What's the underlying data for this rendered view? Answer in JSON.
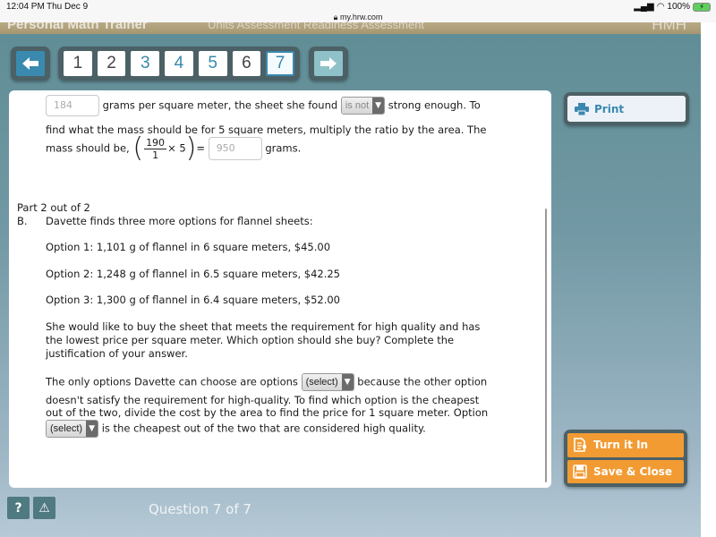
{
  "status_bar": {
    "time": "12:04 PM",
    "date": "Thu Dec 9",
    "url": "my.hrw.com",
    "battery": "100%"
  },
  "app_header": {
    "title": "Personal Math Trainer",
    "menu": "Units   Assessment Readiness   Assessment",
    "brand": "HMH"
  },
  "nav": {
    "prev_icon": "arrow-left-icon",
    "next_icon": "arrow-right-icon",
    "pages": [
      {
        "label": "1",
        "state": "default"
      },
      {
        "label": "2",
        "state": "default"
      },
      {
        "label": "3",
        "state": "visited"
      },
      {
        "label": "4",
        "state": "visited"
      },
      {
        "label": "5",
        "state": "visited"
      },
      {
        "label": "6",
        "state": "default"
      },
      {
        "label": "7",
        "state": "current"
      }
    ]
  },
  "part1": {
    "input1_value": "184",
    "text1": "grams per square meter, the sheet she found",
    "dropdown1_value": "is not",
    "text2": "strong enough. To",
    "line2": "find what the mass should be for 5 square meters, multiply the ratio by the area. The",
    "line3_prefix": "mass should be,",
    "frac_num": "190",
    "frac_den": "1",
    "times": "× 5",
    "equals": "=",
    "input2_value": "950",
    "line3_suffix": "grams."
  },
  "part2": {
    "part_label": "Part 2 out of 2",
    "letter": "B.",
    "intro": "Davette finds three more options for flannel sheets:",
    "options": [
      "Option 1: 1,101 g of flannel in 6 square meters, $45.00",
      "Option 2: 1,248 g of flannel in 6.5 square meters, $42.25",
      "Option 3: 1,300 g of flannel in 6.4 square meters, $52.00"
    ],
    "question_lines": [
      "She would like to buy the sheet that meets the requirement for high quality and has",
      "the lowest price per square meter. Which option should she buy? Complete the",
      "justification of your answer."
    ],
    "answer_a": "The only options Davette can choose are options",
    "dropdown2_value": "(select)",
    "answer_b": "because the other option",
    "answer_c": "doesn't satisfy the requirement for high-quality. To find which option is the cheapest",
    "answer_d": "out of the two, divide the cost by the area to find the price for 1 square meter. Option",
    "dropdown3_value": "(select)",
    "answer_e": "is the cheapest out of the two that are considered high quality."
  },
  "side": {
    "print_label": "Print",
    "turn_in_label": "Turn it In",
    "save_close_label": "Save & Close"
  },
  "footer": {
    "help_label": "?",
    "report_label": "⚠",
    "question_label": "Question 7 of 7"
  },
  "colors": {
    "accent_blue": "#3a88ae",
    "action_orange": "#f29b33",
    "frame_dark": "#4b6166"
  }
}
